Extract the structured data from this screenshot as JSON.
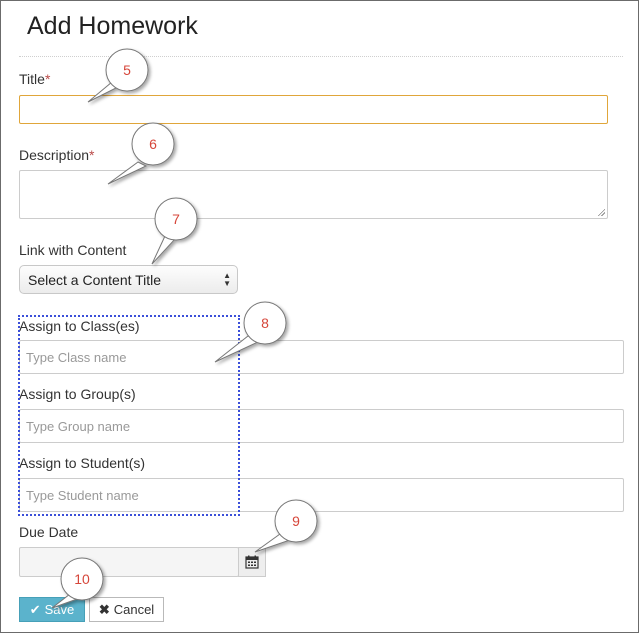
{
  "form": {
    "title": "Add Homework",
    "title_label": "Title",
    "description_label": "Description",
    "required_mark": "*",
    "title_value": "",
    "description_value": "",
    "link_content_label": "Link with Content",
    "link_content_selected": "Select a Content Title",
    "class_label": "Assign to Class(es)",
    "class_placeholder": "Type Class name",
    "group_label": "Assign to Group(s)",
    "group_placeholder": "Type Group name",
    "student_label": "Assign to Student(s)",
    "student_placeholder": "Type Student name",
    "due_date_label": "Due Date",
    "due_date_value": "",
    "save_label": "Save",
    "cancel_label": "Cancel"
  },
  "callouts": [
    "5",
    "6",
    "7",
    "8",
    "9",
    "10"
  ],
  "icons": {
    "calendar": "calendar-icon",
    "save": "check-icon",
    "cancel": "x-icon",
    "select": "updown-arrows-icon"
  },
  "colors": {
    "accent_button": "#5bb3cc",
    "required": "#b94a48",
    "callout": "#d6463a",
    "focus_border": "#e0a63a",
    "highlight_box": "#3b4fd9"
  }
}
